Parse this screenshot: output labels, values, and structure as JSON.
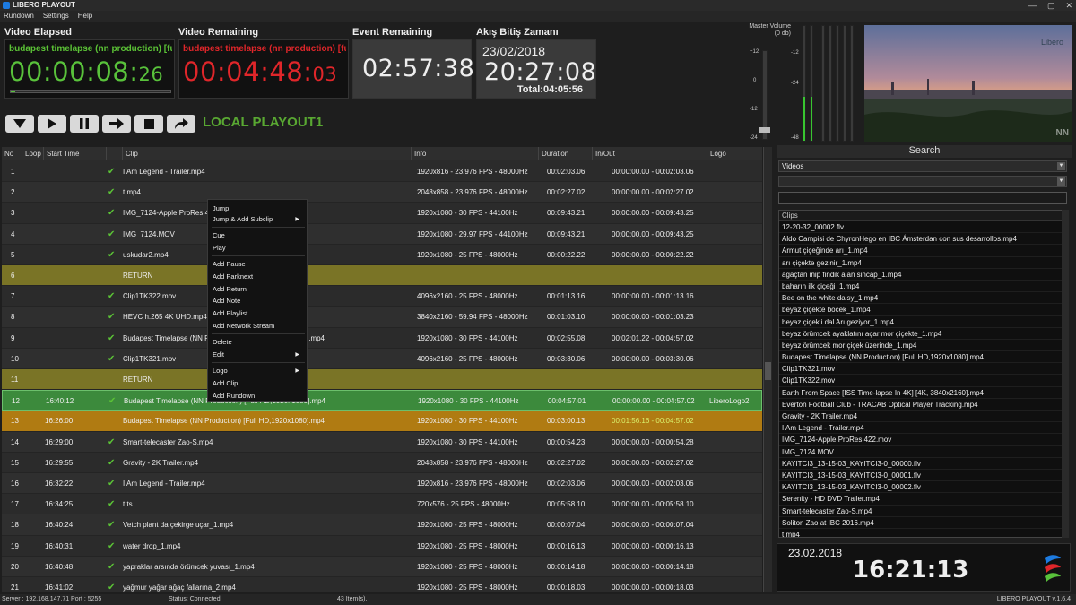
{
  "window": {
    "title": "LIBERO PLAYOUT",
    "controls": [
      "—",
      "▢",
      "✕"
    ]
  },
  "menu": [
    "Rundown",
    "Settings",
    "Help"
  ],
  "video_elapsed": {
    "label": "Video Elapsed",
    "clip": "budapest timelapse (nn production) [fu",
    "time_main": "00:00:08:",
    "time_frames": "26",
    "progress": 0.03
  },
  "video_remaining": {
    "label": "Video Remaining",
    "clip": "budapest timelapse (nn production) [fu",
    "time_main": "00:04:48:",
    "time_frames": "03"
  },
  "event_remaining": {
    "label": "Event Remaining",
    "time": "02:57:38"
  },
  "end_time": {
    "label": "Akış Bitiş Zamanı",
    "date": "23/02/2018",
    "time": "20:27:08",
    "total": "Total:04:05:56"
  },
  "transport": {
    "buttons": [
      "stop-down",
      "play",
      "pause",
      "next",
      "stop",
      "skip"
    ],
    "channel": "LOCAL PLAYOUT1"
  },
  "audio": {
    "label": "Master Volume (0 db)",
    "fader_scale": [
      "+12",
      "0",
      "-12",
      "-24"
    ],
    "meter_scale": [
      "-12",
      "-24",
      "-48"
    ],
    "level_left": 0.38,
    "level_right": 0.38
  },
  "preview": {
    "logo": "Libero",
    "watermark": "NN"
  },
  "table": {
    "columns": [
      "No",
      "Loop",
      "Start Time",
      "",
      "Clip",
      "Info",
      "Duration",
      "In/Out",
      "Logo"
    ],
    "rows": [
      {
        "no": "1",
        "start": "",
        "check": true,
        "clip": "I Am Legend - Trailer.mp4",
        "info": "1920x816 - 23.976 FPS - 48000Hz",
        "duration": "00:02:03.06",
        "inout": "00:00:00.00 - 00:02:03.06",
        "logo": "",
        "type": "normal"
      },
      {
        "no": "2",
        "start": "",
        "check": true,
        "clip": "t.mp4",
        "info": "2048x858 - 23.976 FPS - 48000Hz",
        "duration": "00:02:27.02",
        "inout": "00:00:00.00 - 00:02:27.02",
        "logo": "",
        "type": "normal"
      },
      {
        "no": "3",
        "start": "",
        "check": true,
        "clip": "IMG_7124-Apple ProRes 422.mov",
        "info": "1920x1080 - 30 FPS - 44100Hz",
        "duration": "00:09:43.21",
        "inout": "00:00:00.00 - 00:09:43.25",
        "logo": "",
        "type": "normal"
      },
      {
        "no": "4",
        "start": "",
        "check": true,
        "clip": "IMG_7124.MOV",
        "info": "1920x1080 - 29.97 FPS - 44100Hz",
        "duration": "00:09:43.21",
        "inout": "00:00:00.00 - 00:09:43.25",
        "logo": "",
        "type": "normal"
      },
      {
        "no": "5",
        "start": "",
        "check": true,
        "clip": "uskudar2.mp4",
        "info": "1920x1080 - 25 FPS - 48000Hz",
        "duration": "00:00:22.22",
        "inout": "00:00:00.00 - 00:00:22.22",
        "logo": "",
        "type": "normal"
      },
      {
        "no": "6",
        "start": "",
        "check": false,
        "clip": "RETURN",
        "info": "",
        "duration": "",
        "inout": "",
        "logo": "",
        "type": "return"
      },
      {
        "no": "7",
        "start": "",
        "check": true,
        "clip": "Clip1TK322.mov",
        "info": "4096x2160 - 25 FPS - 48000Hz",
        "duration": "00:01:13.16",
        "inout": "00:00:00.00 - 00:01:13.16",
        "logo": "",
        "type": "normal"
      },
      {
        "no": "8",
        "start": "",
        "check": true,
        "clip": "HEVC h.265 4K UHD.mp4",
        "info": "3840x2160 - 59.94 FPS - 48000Hz",
        "duration": "00:01:03.10",
        "inout": "00:00:00.00 - 00:01:03.23",
        "logo": "",
        "type": "normal"
      },
      {
        "no": "9",
        "start": "",
        "check": true,
        "clip": "Budapest Timelapse (NN Production) [Full HD,1920x1080].mp4",
        "info": "1920x1080 - 30 FPS - 44100Hz",
        "duration": "00:02:55.08",
        "inout": "00:02:01.22 - 00:04:57.02",
        "logo": "",
        "type": "normal"
      },
      {
        "no": "10",
        "start": "",
        "check": true,
        "clip": "Clip1TK321.mov",
        "info": "4096x2160 - 25 FPS - 48000Hz",
        "duration": "00:03:30.06",
        "inout": "00:00:00.00 - 00:03:30.06",
        "logo": "",
        "type": "normal"
      },
      {
        "no": "11",
        "start": "",
        "check": false,
        "clip": "RETURN",
        "info": "",
        "duration": "",
        "inout": "",
        "logo": "",
        "type": "return"
      },
      {
        "no": "12",
        "start": "16:40:12",
        "check": true,
        "clip": "Budapest Timelapse (NN Production) [Full HD,1920x1080].mp4",
        "info": "1920x1080 - 30 FPS - 44100Hz",
        "duration": "00:04:57.01",
        "inout": "00:00:00.00 - 00:04:57.02",
        "logo": "LiberoLogo2",
        "type": "played"
      },
      {
        "no": "13",
        "start": "16:26:00",
        "check": false,
        "clip": "Budapest Timelapse (NN Production) [Full HD,1920x1080].mp4",
        "info": "1920x1080 - 30 FPS - 44100Hz",
        "duration": "00:03:00.13",
        "inout": "00:01:56.16 - 00:04:57.02",
        "logo": "",
        "type": "cued"
      },
      {
        "no": "14",
        "start": "16:29:00",
        "check": true,
        "clip": "Smart-telecaster Zao-S.mp4",
        "info": "1920x1080 - 30 FPS - 44100Hz",
        "duration": "00:00:54.23",
        "inout": "00:00:00.00 - 00:00:54.28",
        "logo": "",
        "type": "normal"
      },
      {
        "no": "15",
        "start": "16:29:55",
        "check": true,
        "clip": "Gravity - 2K Trailer.mp4",
        "info": "2048x858 - 23.976 FPS - 48000Hz",
        "duration": "00:02:27.02",
        "inout": "00:00:00.00 - 00:02:27.02",
        "logo": "",
        "type": "normal"
      },
      {
        "no": "16",
        "start": "16:32:22",
        "check": true,
        "clip": "I Am Legend - Trailer.mp4",
        "info": "1920x816 - 23.976 FPS - 48000Hz",
        "duration": "00:02:03.06",
        "inout": "00:00:00.00 - 00:02:03.06",
        "logo": "",
        "type": "normal"
      },
      {
        "no": "17",
        "start": "16:34:25",
        "check": true,
        "clip": "t.ts",
        "info": "720x576 - 25 FPS - 48000Hz",
        "duration": "00:05:58.10",
        "inout": "00:00:00.00 - 00:05:58.10",
        "logo": "",
        "type": "normal"
      },
      {
        "no": "18",
        "start": "16:40:24",
        "check": true,
        "clip": "Vetch plant da çekirge uçar_1.mp4",
        "info": "1920x1080 - 25 FPS - 48000Hz",
        "duration": "00:00:07.04",
        "inout": "00:00:00.00 - 00:00:07.04",
        "logo": "",
        "type": "normal"
      },
      {
        "no": "19",
        "start": "16:40:31",
        "check": true,
        "clip": "water drop_1.mp4",
        "info": "1920x1080 - 25 FPS - 48000Hz",
        "duration": "00:00:16.13",
        "inout": "00:00:00.00 - 00:00:16.13",
        "logo": "",
        "type": "normal"
      },
      {
        "no": "20",
        "start": "16:40:48",
        "check": true,
        "clip": "yapraklar arsında örümcek yuvası_1.mp4",
        "info": "1920x1080 - 25 FPS - 48000Hz",
        "duration": "00:00:14.18",
        "inout": "00:00:00.00 - 00:00:14.18",
        "logo": "",
        "type": "normal"
      },
      {
        "no": "21",
        "start": "16:41:02",
        "check": true,
        "clip": "yağmur yağar ağaç fallarına_2.mp4",
        "info": "1920x1080 - 25 FPS - 48000Hz",
        "duration": "00:00:18.03",
        "inout": "00:00:00.00 - 00:00:18.03",
        "logo": "",
        "type": "normal"
      }
    ]
  },
  "context_menu": {
    "items": [
      {
        "label": "Jump",
        "submenu": false
      },
      {
        "label": "Jump & Add Subclip",
        "submenu": true
      },
      {
        "label": "Cue",
        "submenu": false
      },
      {
        "label": "Play",
        "submenu": false
      },
      {
        "label": "Add Pause",
        "submenu": false
      },
      {
        "label": "Add Parknext",
        "submenu": false
      },
      {
        "label": "Add Return",
        "submenu": false
      },
      {
        "label": "Add Note",
        "submenu": false
      },
      {
        "label": "Add Playlist",
        "submenu": false
      },
      {
        "label": "Add Network Stream",
        "submenu": false
      },
      {
        "label": "Delete",
        "submenu": false
      },
      {
        "label": "Edit",
        "submenu": true
      },
      {
        "label": "Logo",
        "submenu": true
      },
      {
        "label": "Add Clip",
        "submenu": false
      },
      {
        "label": "Add Rundown",
        "submenu": false
      }
    ]
  },
  "search": {
    "title": "Search",
    "category": "Videos",
    "filter": "",
    "list_header": "Clips",
    "clips": [
      "12-20-32_00002.flv",
      "Aldo Campisi de ChyronHego en IBC Ámsterdan con sus desarrollos.mp4",
      "Armut çiçeğinde arı_1.mp4",
      "arı çiçekte gezinir_1.mp4",
      "ağaçtan inip findik alan sincap_1.mp4",
      "baharın ilk çiçeği_1.mp4",
      "Bee on the white daisy_1.mp4",
      "beyaz çiçekte böcek_1.mp4",
      "beyaz çiçekli dal Arı geziyor_1.mp4",
      "beyaz örümcek ayaklatını açar mor çiçekte_1.mp4",
      "beyaz örümcek mor çiçek üzerinde_1.mp4",
      "Budapest Timelapse (NN Production) [Full HD,1920x1080].mp4",
      "Clip1TK321.mov",
      "Clip1TK322.mov",
      "Earth From Space [ISS Time-lapse In 4K] [4K, 3840x2160].mp4",
      "Everton Football Club - TRACAB Optical Player Tracking.mp4",
      "Gravity - 2K Trailer.mp4",
      "I Am Legend - Trailer.mp4",
      "IMG_7124-Apple ProRes 422.mov",
      "IMG_7124.MOV",
      "KAYITCI3_13-15-03_KAYITCI3-0_00000.flv",
      "KAYITCI3_13-15-03_KAYITCI3-0_00001.flv",
      "KAYITCI3_13-15-03_KAYITCI3-0_00002.flv",
      "Serenity - HD DVD Trailer.mp4",
      "Smart-telecaster Zao-S.mp4",
      "Soliton Zao at IBC 2016.mp4",
      "t.mp4"
    ]
  },
  "clock": {
    "date": "23.02.2018",
    "time": "16:21:13"
  },
  "status": {
    "server": "Server : 192.168.147.71  Port : 5255",
    "connection": "Status: Connected.",
    "items": "43 Item(s).",
    "version": "LIBERO PLAYOUT v.1.6.4"
  },
  "colors": {
    "green": "#59c23b",
    "red": "#e0262a",
    "played": "#3c8a3c",
    "cued": "#b07b12",
    "return": "#7a7426"
  }
}
